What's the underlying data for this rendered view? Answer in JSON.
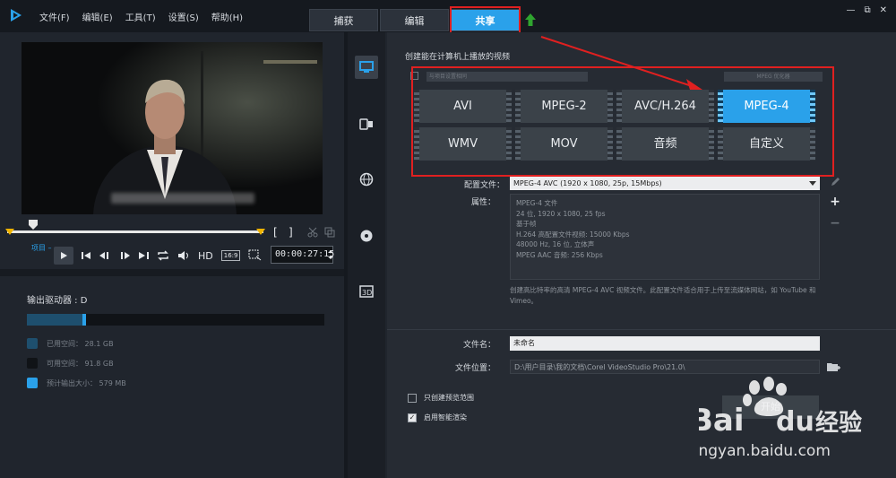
{
  "menu": [
    "文件(F)",
    "编辑(E)",
    "工具(T)",
    "设置(S)",
    "帮助(H)"
  ],
  "tabs": [
    {
      "label": "捕获",
      "active": false
    },
    {
      "label": "编辑",
      "active": false
    },
    {
      "label": "共享",
      "active": true
    }
  ],
  "window_controls": [
    "—",
    "⧉",
    "✕"
  ],
  "player": {
    "project_label": "项目 –",
    "hd_label": "HD",
    "ratio_label": "16:9",
    "timecode": "00:00:27:15",
    "bracket_in": "[",
    "bracket_out": "]"
  },
  "drive": {
    "label": "输出驱动器 : D",
    "used_fraction": 0.19,
    "estimate_fraction": 0.2,
    "legend": [
      {
        "label": "已用空间：  28.1 GB",
        "color": "#1e4f6e"
      },
      {
        "label": "可用空间：  91.8 GB",
        "color": "#101317"
      },
      {
        "label": "预计输出大小：  579 MB",
        "color": "#2aa1ea"
      }
    ]
  },
  "share_heading": "创建能在计算机上播放的视频",
  "dim_row": {
    "select": "与项目设置相同",
    "button": "MPEG 优化器"
  },
  "formats": [
    {
      "label": "AVI",
      "active": false
    },
    {
      "label": "MPEG-2",
      "active": false
    },
    {
      "label": "AVC/H.264",
      "active": false
    },
    {
      "label": "MPEG-4",
      "active": true
    },
    {
      "label": "WMV",
      "active": false
    },
    {
      "label": "MOV",
      "active": false
    },
    {
      "label": "音频",
      "active": false
    },
    {
      "label": "自定义",
      "active": false
    }
  ],
  "profile": {
    "label": "配置文件：",
    "value": "MPEG-4 AVC (1920 x 1080, 25p, 15Mbps)"
  },
  "properties": {
    "label": "属性：",
    "lines": [
      "MPEG-4 文件",
      "24 位, 1920 x 1080, 25 fps",
      "基于帧",
      "H.264 高配置文件视频: 15000 Kbps",
      "48000 Hz, 16 位, 立体声",
      "MPEG AAC 音频: 256 Kbps"
    ]
  },
  "description": "创建高比特率的高清 MPEG-4 AVC 视频文件。此配置文件适合用于上传至流媒体网站，如 YouTube 和 Vimeo。",
  "file_name": {
    "label": "文件名：",
    "value": "未命名"
  },
  "file_location": {
    "label": "文件位置：",
    "value": "D:\\用户目录\\我的文档\\Corel VideoStudio Pro\\21.0\\"
  },
  "checkboxes": [
    {
      "label": "只创建预览范围",
      "checked": false
    },
    {
      "label": "启用智能渲染",
      "checked": true
    }
  ],
  "start_button": "开始",
  "watermark": {
    "brand": "Bai",
    "brand2": "du",
    "cn": "经验",
    "url": "jingyan.baidu.com"
  }
}
